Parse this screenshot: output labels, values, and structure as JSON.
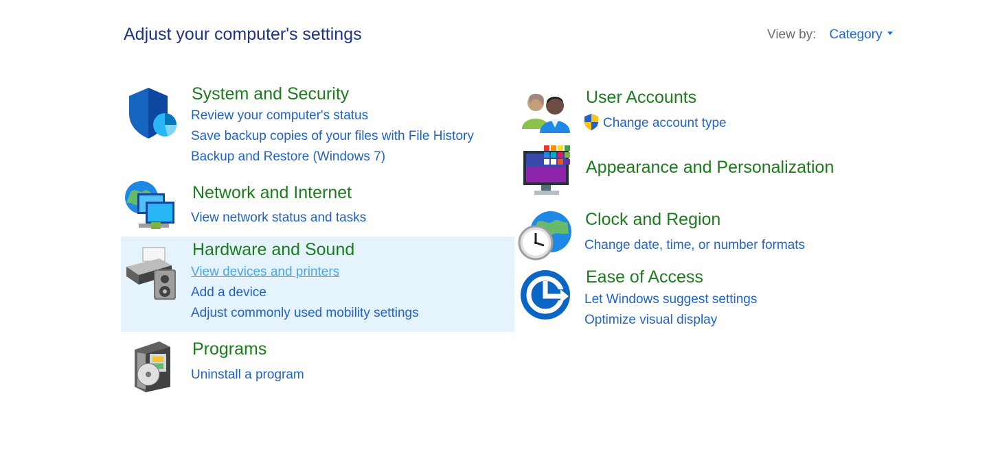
{
  "header": {
    "title": "Adjust your computer's settings",
    "view_by_label": "View by:",
    "view_by_value": "Category"
  },
  "left_categories": [
    {
      "title": "System and Security",
      "icon": "shield-icon",
      "links": [
        "Review your computer's status",
        "Save backup copies of your files with File History",
        "Backup and Restore (Windows 7)"
      ]
    },
    {
      "title": "Network and Internet",
      "icon": "network-globe-icon",
      "links": [
        "View network status and tasks"
      ]
    },
    {
      "title": "Hardware and Sound",
      "icon": "printer-speaker-icon",
      "links": [
        "View devices and printers",
        "Add a device",
        "Adjust commonly used mobility settings"
      ]
    },
    {
      "title": "Programs",
      "icon": "programs-disc-icon",
      "links": [
        "Uninstall a program"
      ]
    }
  ],
  "right_categories": [
    {
      "title": "User Accounts",
      "icon": "users-icon",
      "links": [
        "Change account type"
      ]
    },
    {
      "title": "Appearance and Personalization",
      "icon": "monitor-palette-icon",
      "links": []
    },
    {
      "title": "Clock and Region",
      "icon": "clock-globe-icon",
      "links": [
        "Change date, time, or number formats"
      ]
    },
    {
      "title": "Ease of Access",
      "icon": "ease-of-access-icon",
      "links": [
        "Let Windows suggest settings",
        "Optimize visual display"
      ]
    }
  ],
  "colors": {
    "title": "#1e3287",
    "category_title": "#1c7b1c",
    "link": "#2163c6",
    "hover_background": "#e5f3fd"
  }
}
